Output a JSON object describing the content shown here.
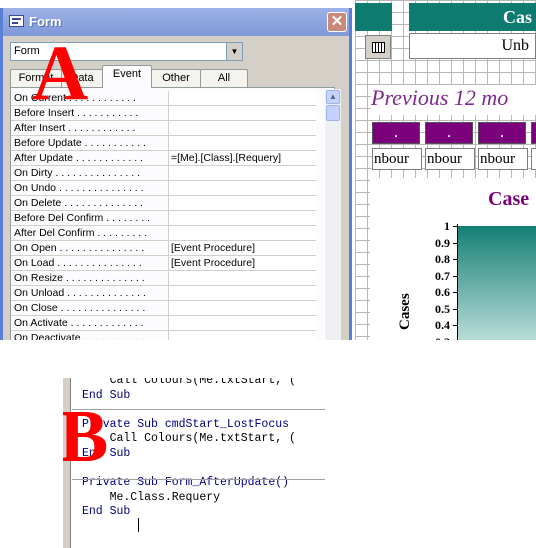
{
  "labels": {
    "a": "A",
    "b": "B"
  },
  "form": {
    "header_text": "Cas",
    "unbound_text": "Unb",
    "previous_label": "Previous 12 mo",
    "purple_boxes": [
      ".",
      ".",
      "."
    ],
    "neighbour_boxes": [
      "nbour",
      "nbour",
      "nbour"
    ],
    "chart_title": "Case"
  },
  "chart_data": {
    "type": "bar",
    "title": "Case",
    "ylabel": "Cases",
    "y_ticks": [
      "1",
      "0.9",
      "0.8",
      "0.7",
      "0.6",
      "0.5",
      "0.4",
      "0.3"
    ],
    "ylim": [
      0,
      1
    ],
    "values": [
      1
    ]
  },
  "property_sheet": {
    "title": "Form",
    "selected_object": "Form",
    "tabs": [
      "Format",
      "Data",
      "Event",
      "Other",
      "All"
    ],
    "active_tab": "Event",
    "properties": [
      {
        "name": "On Current . . . . . . . . . . . .",
        "value": ""
      },
      {
        "name": "Before Insert . . . . . . . . . . .",
        "value": ""
      },
      {
        "name": "After Insert . . . . . . . . . . . .",
        "value": ""
      },
      {
        "name": "Before Update . . . . . . . . . . .",
        "value": ""
      },
      {
        "name": "After Update . . . . . . . . . . . .",
        "value": "=[Me].[Class].[Requery]"
      },
      {
        "name": "On Dirty . . . . . . . . . . . . . . .",
        "value": ""
      },
      {
        "name": "On Undo . . . . . . . . . . . . . . .",
        "value": ""
      },
      {
        "name": "On Delete . . . . . . . . . . . . . .",
        "value": ""
      },
      {
        "name": "Before Del Confirm . . . . . . . .",
        "value": ""
      },
      {
        "name": "After Del Confirm . . . . . . . . .",
        "value": ""
      },
      {
        "name": "On Open . . . . . . . . . . . . . . .",
        "value": "[Event Procedure]"
      },
      {
        "name": "On Load . . . . . . . . . . . . . . .",
        "value": "[Event Procedure]"
      },
      {
        "name": "On Resize . . . . . . . . . . . . . .",
        "value": ""
      },
      {
        "name": "On Unload . . . . . . . . . . . . . .",
        "value": ""
      },
      {
        "name": "On Close . . . . . . . . . . . . . . .",
        "value": ""
      },
      {
        "name": "On Activate . . . . . . . . . . . . .",
        "value": ""
      },
      {
        "name": "On Deactivate . . . . . . . . . . .",
        "value": ""
      }
    ]
  },
  "code_editor": {
    "lines": [
      {
        "text": "    Call Colours(Me.txtStart, (",
        "keyword": false
      },
      {
        "text": "End Sub",
        "keyword": true
      },
      {
        "text": "",
        "keyword": false
      },
      {
        "text": "Private Sub cmdStart_LostFocus",
        "keyword": true
      },
      {
        "text": "    Call Colours(Me.txtStart, (",
        "keyword": false
      },
      {
        "text": "End Sub",
        "keyword": true
      },
      {
        "text": "",
        "keyword": false
      },
      {
        "text": "Private Sub Form_AfterUpdate()",
        "keyword": true
      },
      {
        "text": "    Me.Class.Requery",
        "keyword": false
      },
      {
        "text": "End Sub",
        "keyword": true
      }
    ]
  }
}
